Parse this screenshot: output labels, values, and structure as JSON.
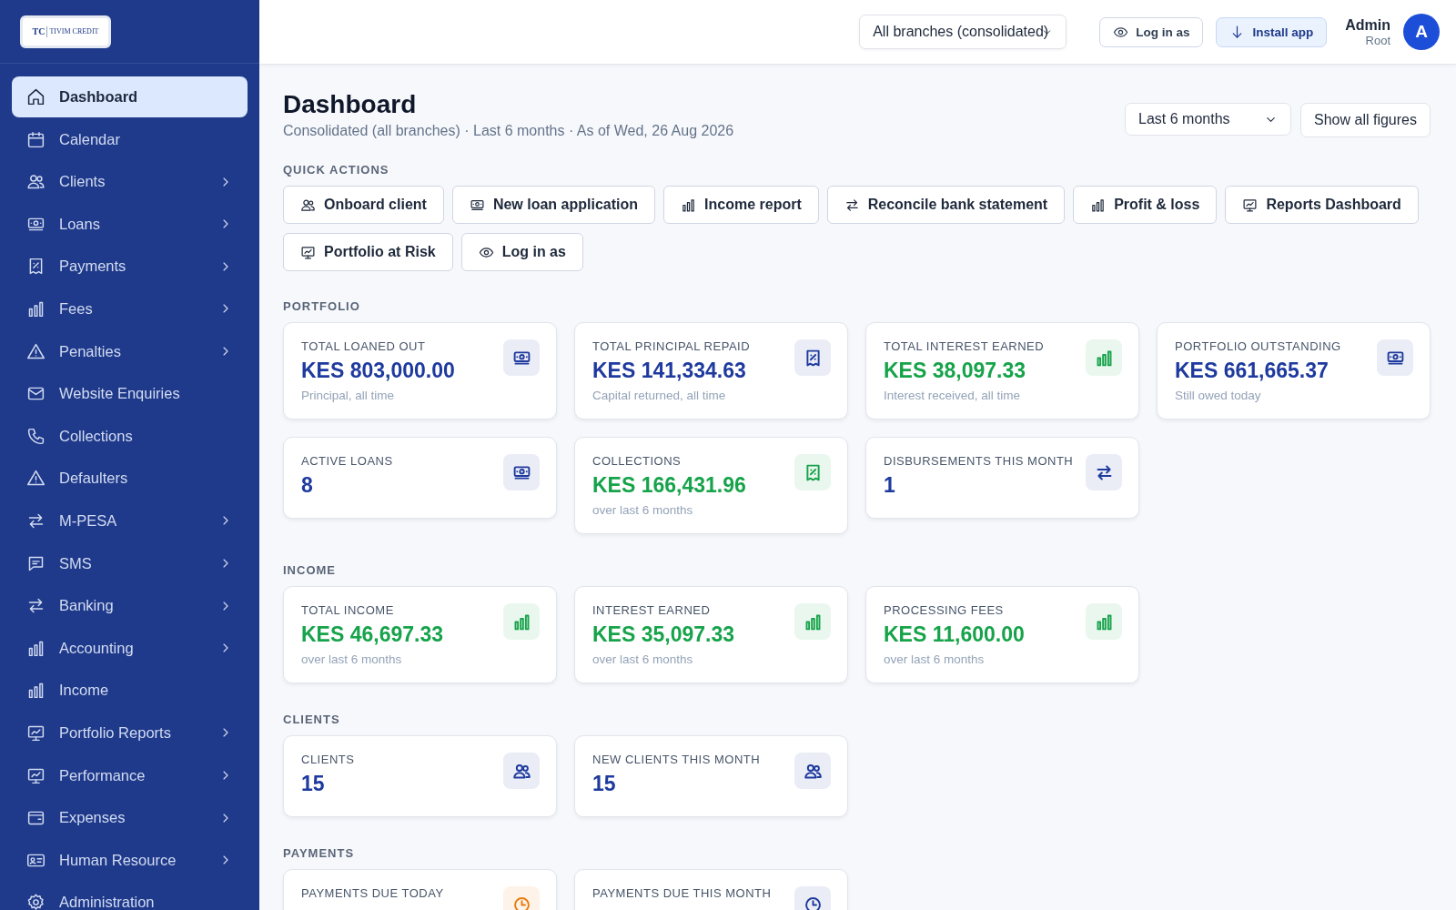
{
  "logo": {
    "mark": "TC",
    "name": "TIVIM CREDIT"
  },
  "sidebar": {
    "items": [
      {
        "label": "Dashboard",
        "submenu": false,
        "selected": true
      },
      {
        "label": "Calendar",
        "submenu": false,
        "selected": false
      },
      {
        "label": "Clients",
        "submenu": true,
        "selected": false
      },
      {
        "label": "Loans",
        "submenu": true,
        "selected": false
      },
      {
        "label": "Payments",
        "submenu": true,
        "selected": false
      },
      {
        "label": "Fees",
        "submenu": true,
        "selected": false
      },
      {
        "label": "Penalties",
        "submenu": true,
        "selected": false
      },
      {
        "label": "Website Enquiries",
        "submenu": false,
        "selected": false
      },
      {
        "label": "Collections",
        "submenu": false,
        "selected": false
      },
      {
        "label": "Defaulters",
        "submenu": false,
        "selected": false
      },
      {
        "label": "M-PESA",
        "submenu": true,
        "selected": false
      },
      {
        "label": "SMS",
        "submenu": true,
        "selected": false
      },
      {
        "label": "Banking",
        "submenu": true,
        "selected": false
      },
      {
        "label": "Accounting",
        "submenu": true,
        "selected": false
      },
      {
        "label": "Income",
        "submenu": false,
        "selected": false
      },
      {
        "label": "Portfolio Reports",
        "submenu": true,
        "selected": false
      },
      {
        "label": "Performance",
        "submenu": true,
        "selected": false
      },
      {
        "label": "Expenses",
        "submenu": true,
        "selected": false
      },
      {
        "label": "Human Resource",
        "submenu": true,
        "selected": false
      },
      {
        "label": "Administration",
        "submenu": false,
        "selected": false
      }
    ]
  },
  "topbar": {
    "branch": "All branches (consolidated)",
    "login_button": "Log in as",
    "install_button": "Install app",
    "user": {
      "name": "Admin",
      "role": "Root",
      "initial": "A"
    }
  },
  "header": {
    "title": "Dashboard",
    "subtitle": "Consolidated (all branches) · Last 6 months · As of Wed, 26 Aug 2026",
    "period": "Last 6 months",
    "figures_button": "Show all figures"
  },
  "quick_actions": {
    "title": "QUICK ACTIONS",
    "buttons": [
      "Onboard client",
      "New loan application",
      "Income report",
      "Reconcile bank statement",
      "Profit & loss",
      "Reports Dashboard",
      "Portfolio at Risk",
      "Log in as"
    ]
  },
  "sections": [
    {
      "title": "PORTFOLIO",
      "cards": [
        {
          "label": "TOTAL LOANED OUT",
          "value": "KES 803,000.00",
          "note": "Principal, all time",
          "color": "#1e3a9e"
        },
        {
          "label": "TOTAL PRINCIPAL REPAID",
          "value": "KES 141,334.63",
          "note": "Capital returned, all time",
          "color": "#1e3a9e"
        },
        {
          "label": "TOTAL INTEREST EARNED",
          "value": "KES 38,097.33",
          "note": "Interest received, all time",
          "color": "#16a34a"
        },
        {
          "label": "PORTFOLIO OUTSTANDING",
          "value": "KES 661,665.37",
          "note": "Still owed today",
          "color": "#1e3a9e"
        },
        {
          "label": "ACTIVE LOANS",
          "value": "8",
          "color": "#1e3a9e"
        },
        {
          "label": "COLLECTIONS",
          "value": "KES 166,431.96",
          "note": "over last 6 months",
          "color": "#16a34a"
        },
        {
          "label": "DISBURSEMENTS THIS MONTH",
          "value": "1",
          "color": "#1e3a9e"
        }
      ]
    },
    {
      "title": "INCOME",
      "cards": [
        {
          "label": "TOTAL INCOME",
          "value": "KES 46,697.33",
          "note": "over last 6 months",
          "color": "#16a34a"
        },
        {
          "label": "INTEREST EARNED",
          "value": "KES 35,097.33",
          "note": "over last 6 months",
          "color": "#16a34a"
        },
        {
          "label": "PROCESSING FEES",
          "value": "KES 11,600.00",
          "note": "over last 6 months",
          "color": "#16a34a"
        }
      ]
    },
    {
      "title": "CLIENTS",
      "cards": [
        {
          "label": "CLIENTS",
          "value": "15",
          "color": "#1e3a9e"
        },
        {
          "label": "NEW CLIENTS THIS MONTH",
          "value": "15",
          "color": "#1e3a9e"
        }
      ]
    },
    {
      "title": "PAYMENTS",
      "cards": [
        {
          "label": "PAYMENTS DUE TODAY",
          "color": "#ea7a0c"
        },
        {
          "label": "PAYMENTS DUE THIS MONTH",
          "color": "#1e3a9e"
        }
      ]
    }
  ]
}
